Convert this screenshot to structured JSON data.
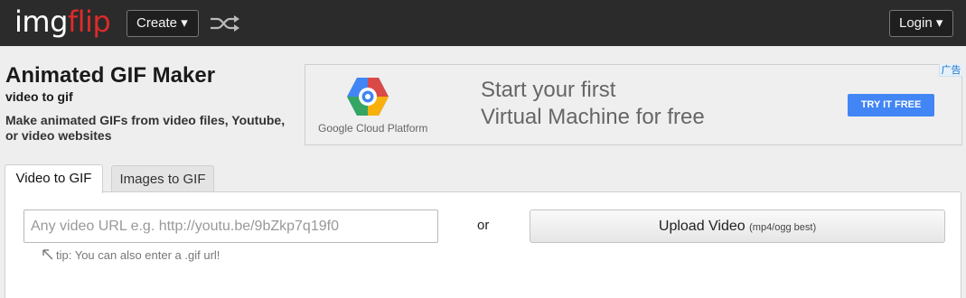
{
  "nav": {
    "logo_part1": "img",
    "logo_part2": "flip",
    "create_label": "Create ▾",
    "shuffle_icon": "shuffle-icon",
    "login_label": "Login ▾"
  },
  "header": {
    "title": "Animated GIF Maker",
    "subtitle": "video to gif",
    "description": "Make animated GIFs from video files, Youtube, or video websites"
  },
  "ad": {
    "marker": "广告",
    "brand": "Google Cloud Platform",
    "headline_line1": "Start your first",
    "headline_line2": "Virtual Machine for free",
    "cta": "TRY IT FREE"
  },
  "tabs": [
    {
      "label": "Video to GIF",
      "active": true
    },
    {
      "label": "Images to GIF",
      "active": false
    }
  ],
  "form": {
    "url_placeholder": "Any video URL e.g. http://youtu.be/9bZkp7q19f0",
    "url_value": "",
    "or_label": "or",
    "upload_label": "Upload Video",
    "upload_hint": "(mp4/ogg best)",
    "tip": "tip: You can also enter a .gif url!"
  },
  "colors": {
    "topbar": "#2b2b2b",
    "logo_accent": "#dd2b2b",
    "cta_blue": "#4285f4"
  }
}
